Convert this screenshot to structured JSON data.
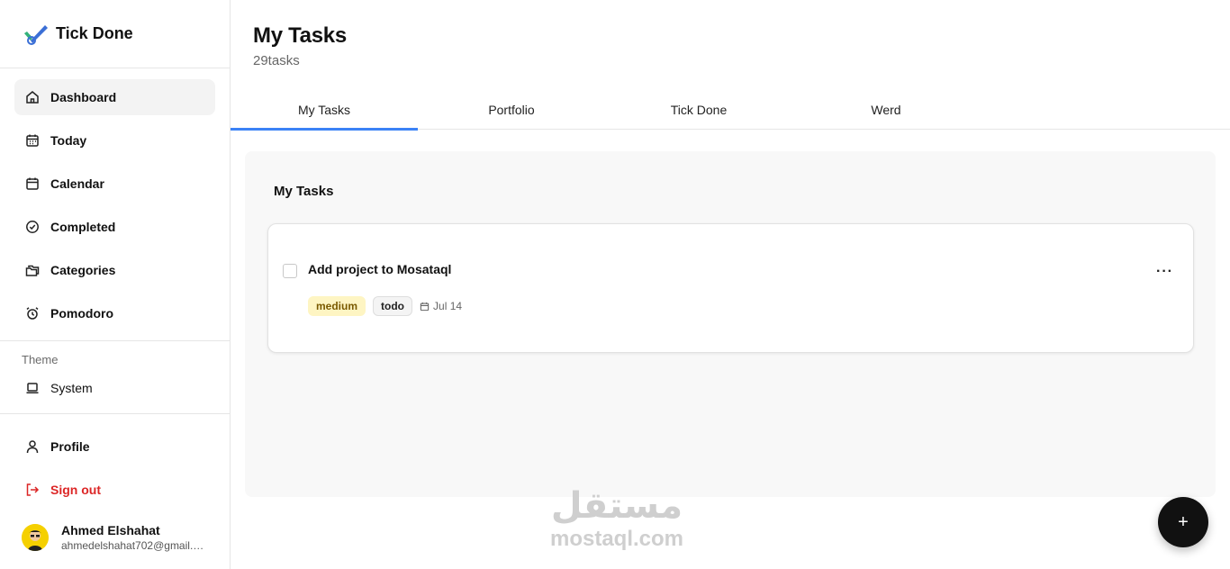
{
  "brand": {
    "name": "Tick Done",
    "icon": "check-logo-icon"
  },
  "sidebar": {
    "items": [
      {
        "label": "Dashboard",
        "icon": "home-icon",
        "active": true
      },
      {
        "label": "Today",
        "icon": "calendar-grid-icon"
      },
      {
        "label": "Calendar",
        "icon": "calendar-icon"
      },
      {
        "label": "Completed",
        "icon": "check-circle-icon"
      },
      {
        "label": "Categories",
        "icon": "folders-icon"
      },
      {
        "label": "Pomodoro",
        "icon": "alarm-clock-icon"
      }
    ],
    "theme_label": "Theme",
    "theme_value": "System",
    "profile_label": "Profile",
    "signout_label": "Sign out"
  },
  "user": {
    "name": "Ahmed Elshahat",
    "email": "ahmedelshahat702@gmail.c..."
  },
  "main": {
    "title": "My Tasks",
    "count": "29tasks",
    "tabs": [
      {
        "label": "My Tasks",
        "active": true
      },
      {
        "label": "Portfolio"
      },
      {
        "label": "Tick Done"
      },
      {
        "label": "Werd"
      }
    ],
    "panel_title": "My Tasks",
    "task": {
      "title": "Add project to Mosataql",
      "priority": "medium",
      "status": "todo",
      "due": "Jul 14",
      "more": "···"
    },
    "fab": "+"
  },
  "watermark": {
    "arabic": "مستقل",
    "latin": "mostaql.com"
  },
  "colors": {
    "accent": "#3b82f6",
    "danger": "#dc2626",
    "priority_bg": "#fef5c3"
  }
}
